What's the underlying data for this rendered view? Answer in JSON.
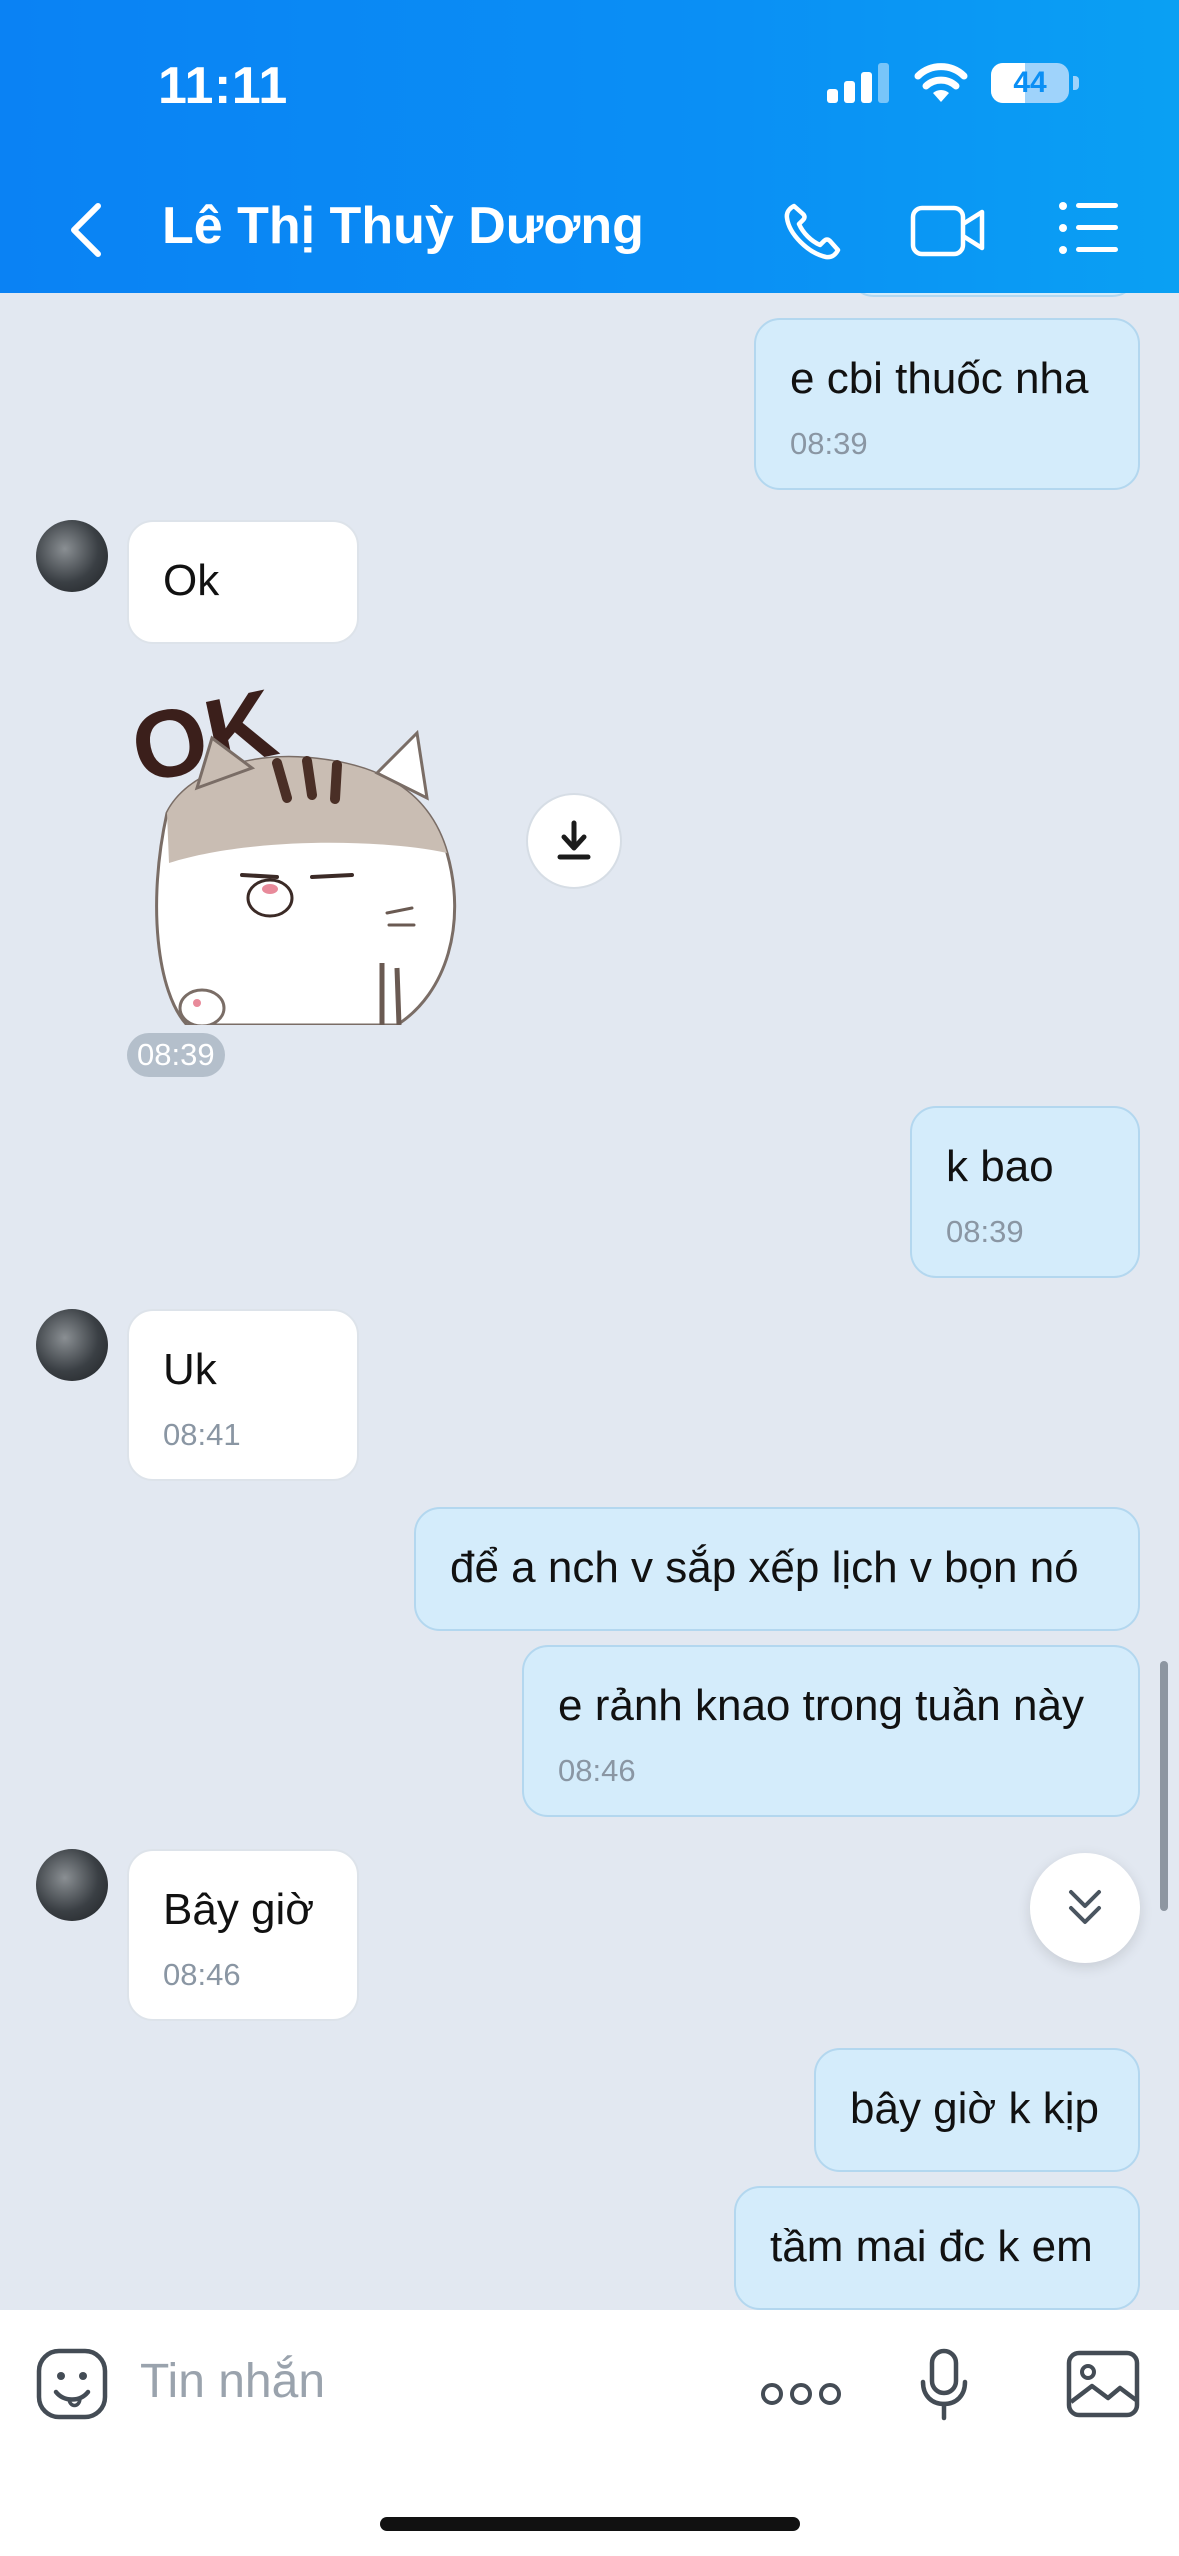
{
  "status_bar": {
    "time": "11:11",
    "battery": "44"
  },
  "header": {
    "contact_name": "Lê Thị Thuỳ Dương"
  },
  "messages": [
    {
      "dir": "out",
      "text": "e cbi thuốc nha",
      "time": "08:39"
    },
    {
      "dir": "in",
      "text": "Ok"
    },
    {
      "dir": "in",
      "sticker": "OK",
      "time": "08:39"
    },
    {
      "dir": "out",
      "text": "k bao",
      "time": "08:39"
    },
    {
      "dir": "in",
      "text": "Uk",
      "time": "08:41"
    },
    {
      "dir": "out",
      "text": "để a nch v sắp xếp lịch v bọn nó"
    },
    {
      "dir": "out",
      "text": "e rảnh knao trong tuần này",
      "time": "08:46"
    },
    {
      "dir": "in",
      "text": "Bây giờ",
      "time": "08:46"
    },
    {
      "dir": "out",
      "text": "bây giờ k kịp"
    },
    {
      "dir": "out",
      "text": "tầm mai đc k em"
    }
  ],
  "input": {
    "placeholder": "Tin nhắn"
  },
  "colors": {
    "header": "#0a8ff5",
    "outgoing_bubble": "#d4ecfb",
    "incoming_bubble": "#ffffff",
    "chat_bg": "#e2e8f1"
  },
  "icons": [
    "back-icon",
    "phone-icon",
    "video-call-icon",
    "menu-icon",
    "download-icon",
    "double-chevron-down-icon",
    "sticker-icon",
    "more-icon",
    "microphone-icon",
    "image-icon"
  ]
}
